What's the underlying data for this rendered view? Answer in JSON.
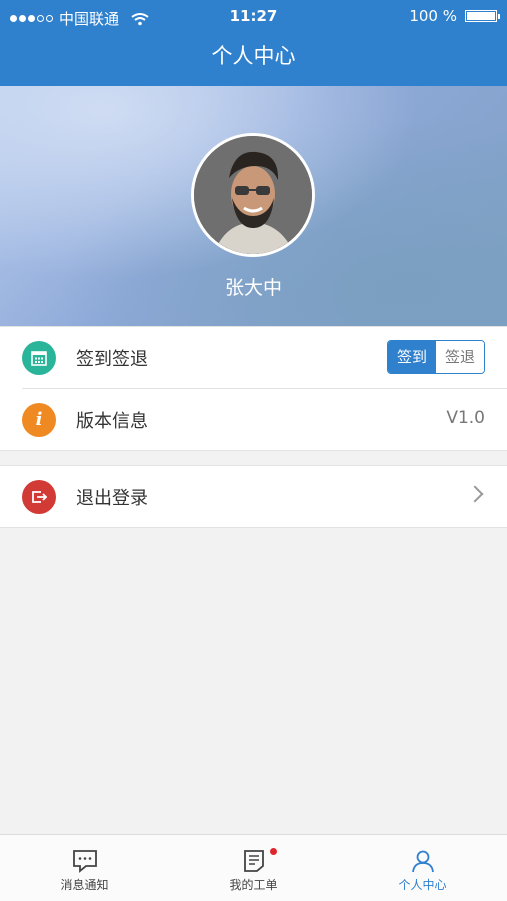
{
  "status_bar": {
    "carrier": "中国联通",
    "time": "11:27",
    "battery": "100 %",
    "signal_bars": 3
  },
  "nav": {
    "title": "个人中心"
  },
  "profile": {
    "name": "张大中"
  },
  "menu": {
    "checkin": {
      "label": "签到签退",
      "segment_on": "签到",
      "segment_off": "签退"
    },
    "version": {
      "label": "版本信息",
      "value": "V1.0"
    },
    "logout": {
      "label": "退出登录"
    }
  },
  "tabs": [
    {
      "label": "消息通知",
      "icon": "message-icon"
    },
    {
      "label": "我的工单",
      "icon": "document-icon",
      "badge": true
    },
    {
      "label": "个人中心",
      "icon": "person-icon",
      "active": true
    }
  ],
  "colors": {
    "primary": "#2f80cd",
    "checkin_icon": "#2ab59a",
    "version_icon": "#ef8a22",
    "logout_icon": "#d23a35",
    "badge": "#e0262d"
  }
}
